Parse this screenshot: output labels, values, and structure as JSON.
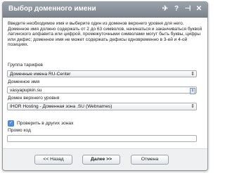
{
  "dialog": {
    "title": "Выбор доменного имени",
    "controls": [
      "✈",
      "?",
      "⊣",
      "✕"
    ]
  },
  "intro_text": "Введите необходимое имя и выберите один из доменов верхнего уровня для него. Доменное имя должно содержать от 2 до 63 символов, начинаться и заканчиваться буквой латинского алфавита или цифрой, промежуточными символами могут быть буквы, цифры или дефис; доменное имя не может содержать дефисы одновременно в 3-ей и 4-ой позициях.",
  "fields": {
    "tariff_group": {
      "label": "Группа тарифов",
      "value": "Доменные имена RU-Center"
    },
    "domain_name": {
      "label": "Доменное имя",
      "value": "vasyapupkin.su"
    },
    "top_level_domain": {
      "label": "Домен верхнего уровня",
      "value": "IHOR Hosting - Доменная зона .SU (Webnames)"
    },
    "check_other_zones": {
      "label": "Проверить в других зонах",
      "checked": true
    },
    "promo_code": {
      "label": "Промо код",
      "value": ""
    }
  },
  "buttons": {
    "back": "<< Назад",
    "next": "Далее >>",
    "cancel": "Отмена"
  }
}
